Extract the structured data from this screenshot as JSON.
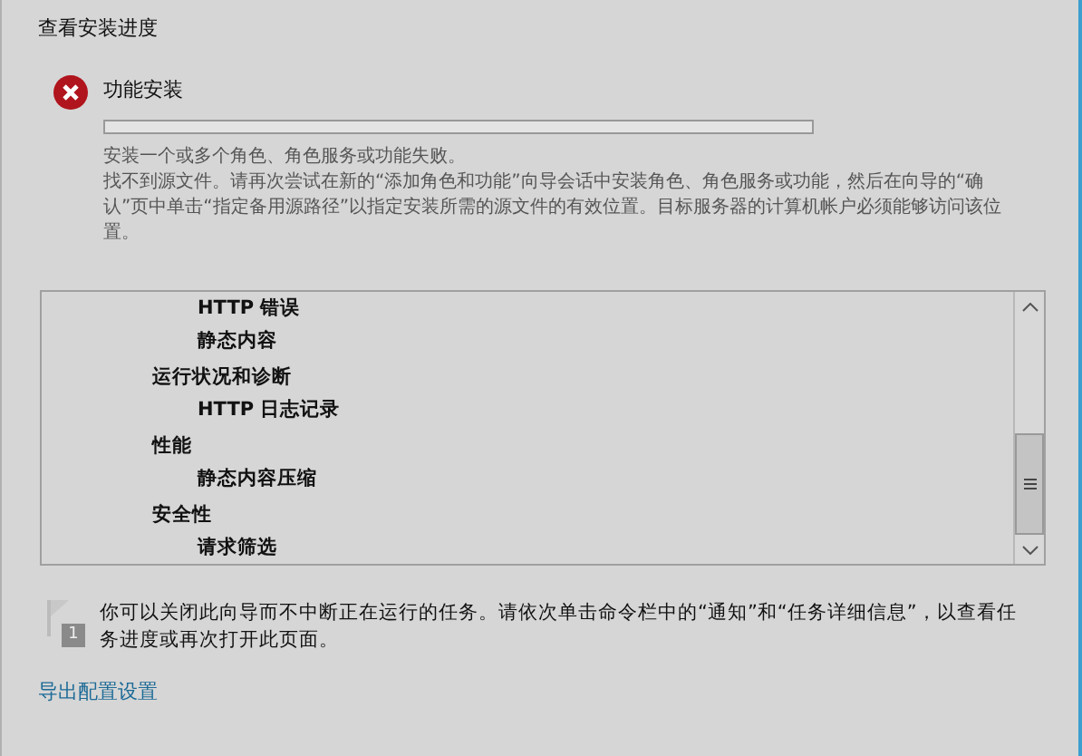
{
  "title": "查看安装进度",
  "task": {
    "failed": true,
    "name": "功能安装",
    "level": 0,
    "messages": [
      "安装一个或多个角色、角色服务或功能失败。",
      "找不到源文件。请再次尝试在新的“添加角色和功能”向导会话中安装角色、角色服务或功能，然后在向导的“确认”页中单击“指定备用源路径”以指定安装所需的源文件的有效位置。目标服务器的计算机帐户必须能够访问该位置。"
    ]
  },
  "features": [
    {
      "children": [
        {
          "label": "HTTP 错误"
        },
        {
          "label": "静态内容"
        }
      ]
    },
    {
      "label": "运行状况和诊断",
      "children": [
        {
          "label": "HTTP 日志记录"
        }
      ]
    },
    {
      "label": "性能",
      "children": [
        {
          "label": "静态内容压缩"
        }
      ]
    },
    {
      "label": "安全性",
      "children": [
        {
          "label": "请求筛选"
        }
      ]
    }
  ],
  "note": {
    "badge": "1",
    "text": "你可以关闭此向导而不中断正在运行的任务。请依次单击命令栏中的“通知”和“任务详细信息”，以查看任务进度或再次打开此页面。"
  },
  "link": "导出配置设置"
}
